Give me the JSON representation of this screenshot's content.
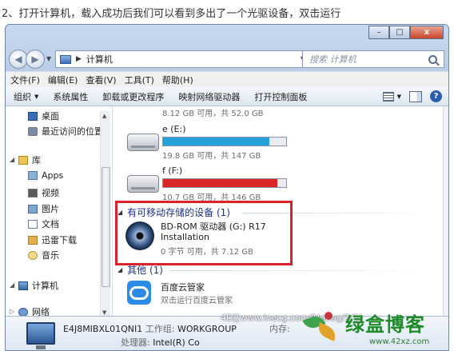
{
  "caption": "2、打开计算机，载入成功后我们可以看到多出了一个光驱设备，双击运行",
  "window": {
    "controls": {
      "minimize": "–",
      "maximize": "□",
      "close": "x"
    }
  },
  "navigation": {
    "back_glyph": "◀",
    "forward_glyph": "▶",
    "address_path": "计算机",
    "search_placeholder": "搜索 计算机"
  },
  "menu": [
    "文件(F)",
    "编辑(E)",
    "查看(V)",
    "工具(T)",
    "帮助(H)"
  ],
  "commands": [
    "组织",
    "系统属性",
    "卸载或更改程序",
    "映射网络驱动器",
    "打开控制面板"
  ],
  "nav_pane": {
    "items": [
      {
        "label": "桌面",
        "icon": "desktop-icon"
      },
      {
        "label": "最近访问的位置",
        "icon": "recent-places-icon"
      },
      {
        "label": "库",
        "icon": "library-icon"
      },
      {
        "label": "Apps",
        "icon": "apps-folder-icon"
      },
      {
        "label": "视频",
        "icon": "videos-icon"
      },
      {
        "label": "图片",
        "icon": "pictures-icon"
      },
      {
        "label": "文档",
        "icon": "documents-icon"
      },
      {
        "label": "迅雷下载",
        "icon": "thunder-download-icon"
      },
      {
        "label": "音乐",
        "icon": "music-icon"
      },
      {
        "label": "计算机",
        "icon": "computer-icon"
      },
      {
        "label": "网络",
        "icon": "network-icon"
      }
    ]
  },
  "drives": [
    {
      "name": "",
      "info": "8.12 GB 可用，共 52.0 GB",
      "fill": null,
      "color": "#26a0da"
    },
    {
      "name": "e (E:)",
      "info": "19.8 GB 可用，共 147 GB",
      "fill": 0.865,
      "color": "#26a0da"
    },
    {
      "name": "f (F:)",
      "info": "10.7 GB 可用，共 146 GB",
      "fill": 0.927,
      "color": "#da2626"
    }
  ],
  "removable_group": "有可移动存储的设备 (1)",
  "dvd": {
    "name": "BD-ROM 驱动器 (G:) R17",
    "label": "Installation",
    "info": "0 字节 可用，共 7.12 GB"
  },
  "other_group": "其他 (1)",
  "app": {
    "name": "百度云管家",
    "desc": "双击运行百度云管家"
  },
  "details": {
    "computer_name": "E4J8MIBXL01QNI1",
    "workgroup_label": "工作组:",
    "workgroup": "WORKGROUP",
    "memory_label": "内存:",
    "cpu_label": "处理器:",
    "cpu": "Intel(R) Co"
  },
  "watermark": "4D[[www.lnecg.com/1lebog/1/1]",
  "logo": {
    "title": "绿盒博客",
    "url": "www.42xz.com"
  },
  "colors": {
    "accent_blue": "#26a0da",
    "full_red": "#da2626",
    "highlight_red": "#d9232e",
    "group_blue": "#1e3287",
    "logo_green": "#1f8a2a"
  }
}
